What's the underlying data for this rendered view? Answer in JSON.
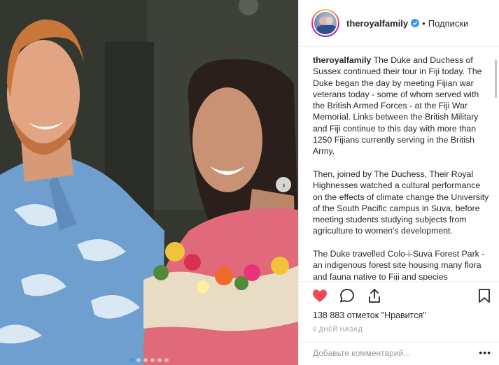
{
  "post": {
    "username": "theroyalfamily",
    "follow_label": "Подписки",
    "separator": "•",
    "caption_user": "theroyalfamily",
    "caption_p1": " The Duke and Duchess of Sussex continued their tour in Fiji today. The Duke began the day by meeting Fijian war veterans today - some of whom served with the British Armed Forces - at the Fiji War Memorial. Links between the British Military and Fiji continue to this day with more than 1250 Fijians currently serving in the British Army.",
    "caption_p2": "Then, joined by The Duchess, Their Royal Highnesses watched a cultural performance on the effects of climate change the University of the South Pacific campus in Suva, before meeting students studying subjects from agriculture to women's development.",
    "caption_p3": "The Duke travelled Colo-i-Suva Forest Park - an indigenous forest site housing many flora and fauna native to Fiji and species",
    "likes": "138 883 отметок \"Нравится\"",
    "time": "6 дней назад",
    "comment_placeholder": "Добавьте комментарий...",
    "more_label": "•••"
  },
  "carousel": {
    "slide_count": 6,
    "active_index": 0
  },
  "icons": {
    "like": "heart-filled-icon",
    "comment": "comment-icon",
    "share": "share-icon",
    "save": "bookmark-icon",
    "verified": "verified-badge-icon",
    "next": "chevron-right-icon"
  },
  "colors": {
    "like": "#ed4956",
    "verified": "#3897f0",
    "text": "#262626",
    "muted": "#999999"
  }
}
